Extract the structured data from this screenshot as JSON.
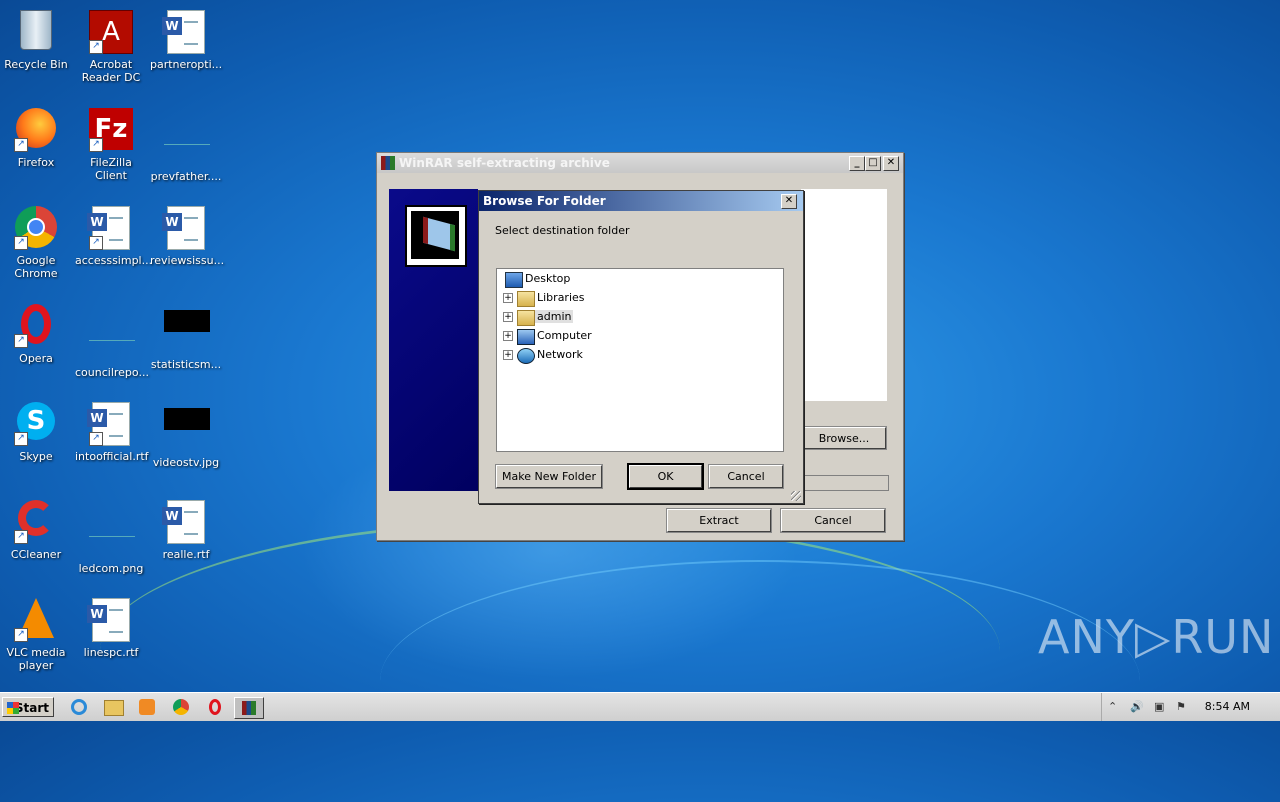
{
  "desktop": {
    "icons": [
      {
        "label": "Recycle Bin"
      },
      {
        "label": "Acrobat Reader DC"
      },
      {
        "label": "partneropti..."
      },
      {
        "label": "Firefox"
      },
      {
        "label": "FileZilla Client"
      },
      {
        "label": "prevfather...."
      },
      {
        "label": "Google Chrome"
      },
      {
        "label": "accesssimpl..."
      },
      {
        "label": "reviewsissu..."
      },
      {
        "label": "Opera"
      },
      {
        "label": "councilrepo..."
      },
      {
        "label": "statisticsm..."
      },
      {
        "label": "Skype"
      },
      {
        "label": "intoofficial.rtf"
      },
      {
        "label": "videostv.jpg"
      },
      {
        "label": "CCleaner"
      },
      {
        "label": "ledcom.png"
      },
      {
        "label": "realle.rtf"
      },
      {
        "label": "VLC media player"
      },
      {
        "label": "linespc.rtf"
      }
    ]
  },
  "winrar": {
    "title": "WinRAR self-extracting archive",
    "browse_label": "Browse...",
    "extract_label": "Extract",
    "cancel_label": "Cancel"
  },
  "browse_dialog": {
    "title": "Browse For Folder",
    "prompt": "Select destination folder",
    "tree": [
      {
        "label": "Desktop",
        "icon": "desktop-icon"
      },
      {
        "label": "Libraries",
        "icon": "libraries-icon"
      },
      {
        "label": "admin",
        "icon": "user-folder-icon",
        "selected": true
      },
      {
        "label": "Computer",
        "icon": "computer-icon"
      },
      {
        "label": "Network",
        "icon": "network-icon"
      }
    ],
    "make_folder_label": "Make New Folder",
    "ok_label": "OK",
    "cancel_label": "Cancel"
  },
  "taskbar": {
    "start_label": "Start",
    "clock": "8:54 AM"
  },
  "watermark": "ANY▷RUN"
}
